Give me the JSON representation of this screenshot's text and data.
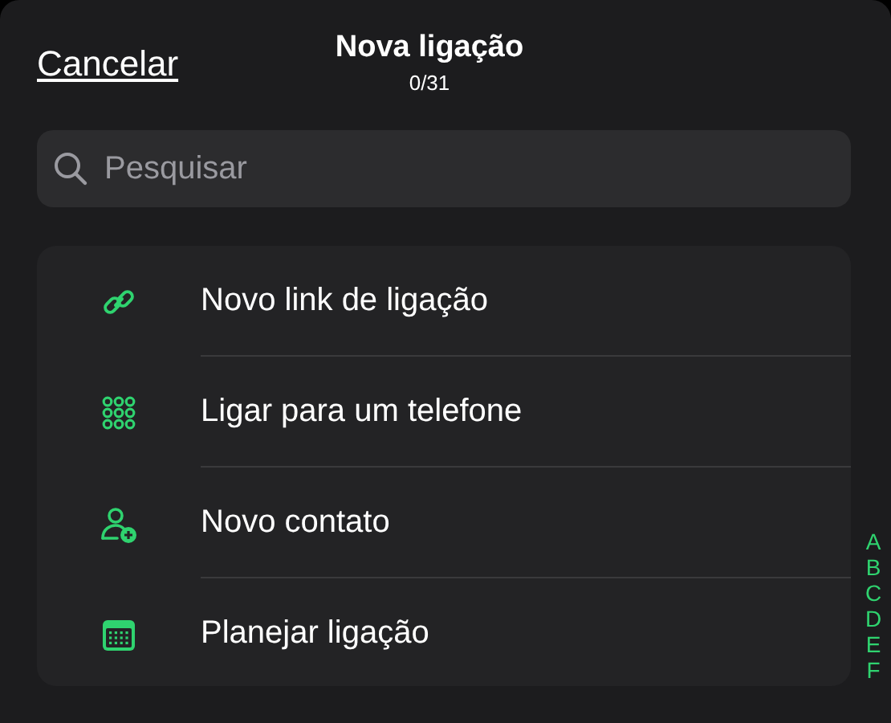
{
  "header": {
    "cancel": "Cancelar",
    "title": "Nova ligação",
    "counter": "0/31"
  },
  "search": {
    "placeholder": "Pesquisar"
  },
  "actions": [
    {
      "kind": "link",
      "label": "Novo link de ligação"
    },
    {
      "kind": "keypad",
      "label": "Ligar para um telefone"
    },
    {
      "kind": "contact",
      "label": "Novo contato"
    },
    {
      "kind": "calendar",
      "label": "Planejar ligação"
    }
  ],
  "index_letters": [
    "A",
    "B",
    "C",
    "D",
    "E",
    "F"
  ]
}
